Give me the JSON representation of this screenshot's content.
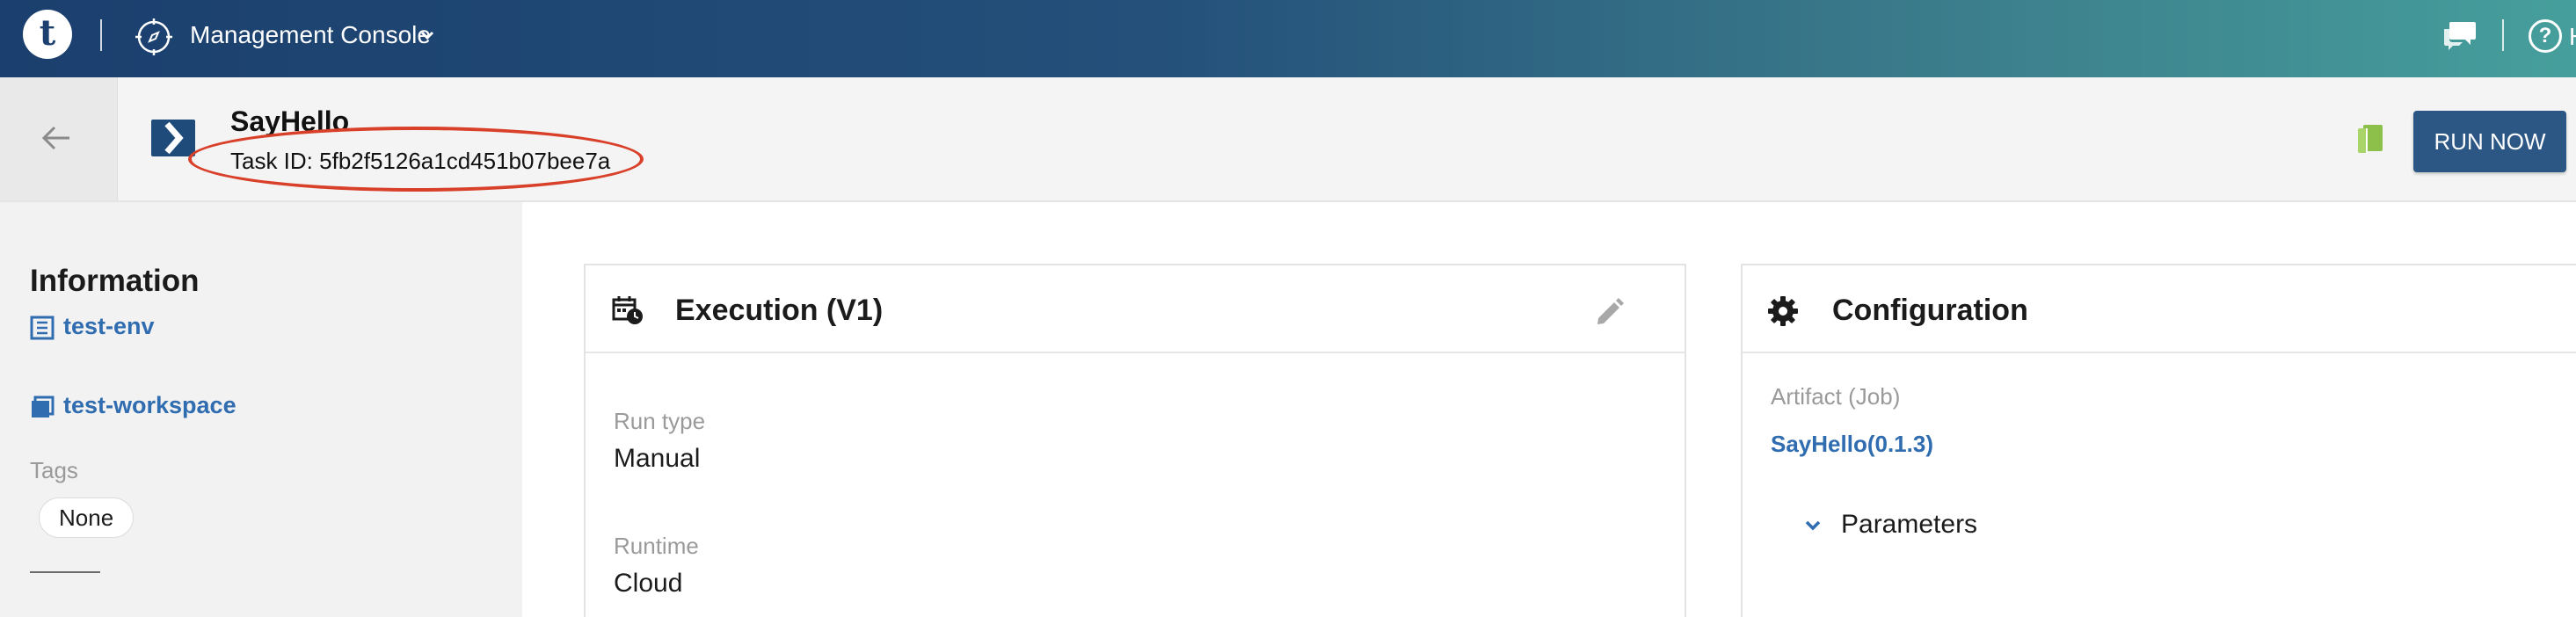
{
  "topbar": {
    "logo_letter": "t",
    "console_label": "Management Console",
    "help_label": "Help"
  },
  "header": {
    "task_name": "SayHello",
    "task_id": "Task ID: 5fb2f5126a1cd451b07bee7a",
    "run_button": "RUN NOW"
  },
  "sidebar": {
    "title": "Information",
    "environment": "test-env",
    "workspace": "test-workspace",
    "tags_label": "Tags",
    "tag_value": "None"
  },
  "execution": {
    "title": "Execution (V1)",
    "run_type_label": "Run type",
    "run_type_value": "Manual",
    "runtime_label": "Runtime",
    "runtime_value": "Cloud"
  },
  "configuration": {
    "title": "Configuration",
    "artifact_label": "Artifact (Job)",
    "artifact_value": "SayHello(0.1.3)",
    "parameters_label": "Parameters"
  },
  "colors": {
    "accent": "#2c5784",
    "link": "#2f6cb0",
    "highlight": "#d9402a",
    "book_icon": "#8cc04b"
  }
}
